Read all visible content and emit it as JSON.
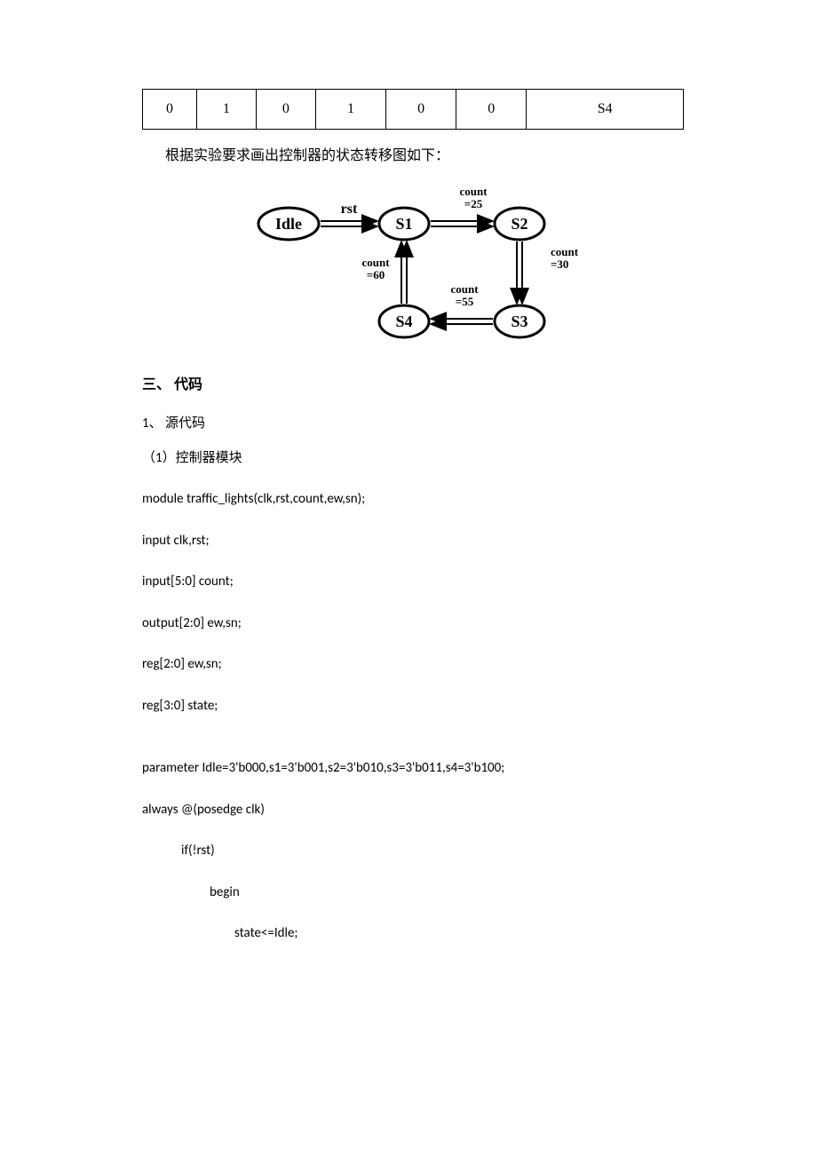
{
  "table": {
    "cells": [
      "0",
      "1",
      "0",
      "1",
      "0",
      "0",
      "S4"
    ]
  },
  "caption": "根据实验要求画出控制器的状态转移图如下：",
  "diagram": {
    "idle": "Idle",
    "s1": "S1",
    "s2": "S2",
    "s3": "S3",
    "s4": "S4",
    "rst": "rst",
    "count60a": "count",
    "count60b": "=60",
    "count25a": "count",
    "count25b": "=25",
    "count30a": "count",
    "count30b": "=30",
    "count55a": "count",
    "count55b": "=55"
  },
  "heading_code": "三、 代码",
  "sub_source": "1、 源代码",
  "sub_module": "（1）控制器模块",
  "code": {
    "l1": "module traffic_lights(clk,rst,count,ew,sn);",
    "l2": "input clk,rst;",
    "l3": "input[5:0] count;",
    "l4": "output[2:0] ew,sn;",
    "l5": "reg[2:0] ew,sn;",
    "l6": "reg[3:0] state;",
    "l7": "parameter    Idle=3'b000,s1=3'b001,s2=3'b010,s3=3'b011,s4=3'b100;",
    "l8": "always @(posedge clk)",
    "l9": "if(!rst)",
    "l10": "begin",
    "l11": "state<=Idle;"
  }
}
